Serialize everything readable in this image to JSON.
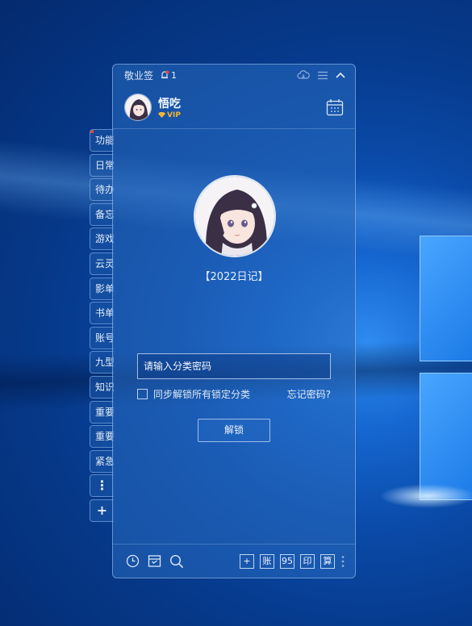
{
  "app": {
    "title": "敬业签",
    "notification_count": "1"
  },
  "user": {
    "name": "悟吃",
    "badge": "VIP"
  },
  "sidebar": {
    "tabs": [
      {
        "label": "功能"
      },
      {
        "label": "日常"
      },
      {
        "label": "待办"
      },
      {
        "label": "备忘"
      },
      {
        "label": "游戏"
      },
      {
        "label": "云灵"
      },
      {
        "label": "影单"
      },
      {
        "label": "书单"
      },
      {
        "label": "账号"
      },
      {
        "label": "九型"
      },
      {
        "label": "知识"
      },
      {
        "label": "重要"
      },
      {
        "label": "重要"
      },
      {
        "label": "紧急"
      }
    ],
    "more_label": "⋮",
    "add_label": "+"
  },
  "main": {
    "category_name": "【2022日记】",
    "password_placeholder": "请输入分类密码",
    "sync_label": "同步解锁所有锁定分类",
    "forgot_label": "忘记密码?",
    "unlock_label": "解锁"
  },
  "bottom": {
    "buttons": [
      {
        "label": "+"
      },
      {
        "label": "账"
      },
      {
        "label": "95"
      },
      {
        "label": "印"
      },
      {
        "label": "算"
      }
    ]
  },
  "colors": {
    "accent": "#2a6ac0",
    "vip": "#f2b631",
    "alert": "#e24b3b"
  },
  "icons": [
    "bell-icon",
    "cloud-icon",
    "menu-icon",
    "collapse-icon",
    "calendar-icon",
    "clock-icon",
    "archive-icon",
    "search-icon",
    "more-vertical-icon"
  ]
}
